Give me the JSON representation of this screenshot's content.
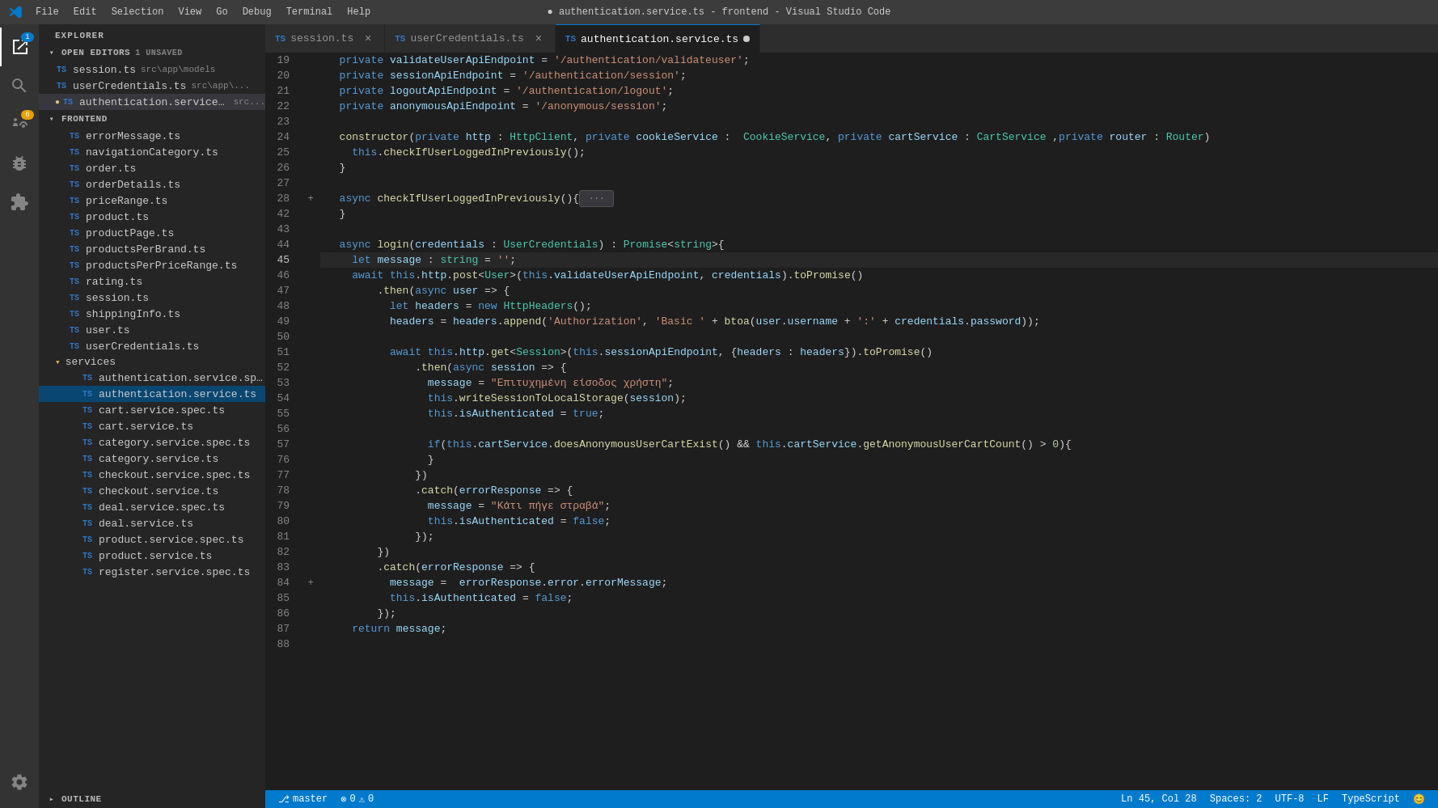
{
  "titlebar": {
    "title": "● authentication.service.ts - frontend - Visual Studio Code",
    "menu_items": [
      "File",
      "Edit",
      "Selection",
      "View",
      "Go",
      "Debug",
      "Terminal",
      "Help"
    ]
  },
  "tabs": [
    {
      "id": "session",
      "label": "session.ts",
      "type": "ts",
      "active": false,
      "unsaved": false
    },
    {
      "id": "userCredentials",
      "label": "userCredentials.ts",
      "type": "ts",
      "active": false,
      "unsaved": false
    },
    {
      "id": "authService",
      "label": "authentication.service.ts",
      "type": "ts",
      "active": true,
      "unsaved": true
    }
  ],
  "sidebar": {
    "title": "EXPLORER",
    "open_editors_label": "OPEN EDITORS",
    "open_editors_badge": "1 UNSAVED",
    "frontend_label": "FRONTEND",
    "outline_label": "OUTLINE",
    "open_files": [
      {
        "name": "session.ts",
        "path": "src\\app\\models",
        "type": "ts",
        "unsaved": false
      },
      {
        "name": "userCredentials.ts",
        "path": "src\\app\\...",
        "type": "ts",
        "unsaved": false
      },
      {
        "name": "authentication.service.ts",
        "path": "src...",
        "type": "ts",
        "unsaved": true,
        "dot": true
      }
    ],
    "files": [
      {
        "name": "errorMessage.ts",
        "type": "ts",
        "indent": 2
      },
      {
        "name": "navigationCategory.ts",
        "type": "ts",
        "indent": 2
      },
      {
        "name": "order.ts",
        "type": "ts",
        "indent": 2
      },
      {
        "name": "orderDetails.ts",
        "type": "ts",
        "indent": 2
      },
      {
        "name": "priceRange.ts",
        "type": "ts",
        "indent": 2
      },
      {
        "name": "product.ts",
        "type": "ts",
        "indent": 2
      },
      {
        "name": "productPage.ts",
        "type": "ts",
        "indent": 2
      },
      {
        "name": "productsPerBrand.ts",
        "type": "ts",
        "indent": 2
      },
      {
        "name": "productsPerPriceRange.ts",
        "type": "ts",
        "indent": 2
      },
      {
        "name": "rating.ts",
        "type": "ts",
        "indent": 2
      },
      {
        "name": "session.ts",
        "type": "ts",
        "indent": 2
      },
      {
        "name": "shippingInfo.ts",
        "type": "ts",
        "indent": 2
      },
      {
        "name": "user.ts",
        "type": "ts",
        "indent": 2
      },
      {
        "name": "userCredentials.ts",
        "type": "ts",
        "indent": 2
      },
      {
        "name": "services",
        "type": "folder",
        "indent": 1
      },
      {
        "name": "authentication.service.sp...",
        "type": "ts",
        "indent": 3
      },
      {
        "name": "authentication.service.ts",
        "type": "ts",
        "indent": 3,
        "active": true
      },
      {
        "name": "cart.service.spec.ts",
        "type": "ts",
        "indent": 3
      },
      {
        "name": "cart.service.ts",
        "type": "ts",
        "indent": 3
      },
      {
        "name": "category.service.spec.ts",
        "type": "ts",
        "indent": 3
      },
      {
        "name": "category.service.ts",
        "type": "ts",
        "indent": 3
      },
      {
        "name": "checkout.service.spec.ts",
        "type": "ts",
        "indent": 3
      },
      {
        "name": "checkout.service.ts",
        "type": "ts",
        "indent": 3
      },
      {
        "name": "deal.service.spec.ts",
        "type": "ts",
        "indent": 3
      },
      {
        "name": "deal.service.ts",
        "type": "ts",
        "indent": 3
      },
      {
        "name": "product.service.spec.ts",
        "type": "ts",
        "indent": 3
      },
      {
        "name": "product.service.ts",
        "type": "ts",
        "indent": 3
      },
      {
        "name": "register.service.spec.ts",
        "type": "ts",
        "indent": 3
      }
    ]
  },
  "code_lines": [
    {
      "num": 19,
      "content": "  private validateUserApiEndpoint = '/authentication/validateuser';"
    },
    {
      "num": 20,
      "content": "  private sessionApiEndpoint = '/authentication/session';"
    },
    {
      "num": 21,
      "content": "  private logoutApiEndpoint = '/authentication/logout';"
    },
    {
      "num": 22,
      "content": "  private anonymousApiEndpoint = '/anonymous/session';"
    },
    {
      "num": 23,
      "content": ""
    },
    {
      "num": 24,
      "content": "  constructor(private http : HttpClient, private cookieService :  CookieService, private cartService : CartService ,private router : Router)"
    },
    {
      "num": 25,
      "content": "    this.checkIfUserLoggedInPreviously();"
    },
    {
      "num": 26,
      "content": "  }"
    },
    {
      "num": 27,
      "content": ""
    },
    {
      "num": 28,
      "content": "  async checkIfUserLoggedInPreviously(){ ···",
      "folded": true
    },
    {
      "num": 42,
      "content": "  }"
    },
    {
      "num": 43,
      "content": ""
    },
    {
      "num": 44,
      "content": "  async login(credentials : UserCredentials) : Promise<string>{"
    },
    {
      "num": 45,
      "content": "    let message : string = '';",
      "current": true
    },
    {
      "num": 46,
      "content": "    await this.http.post<User>(this.validateUserApiEndpoint, credentials).toPromise()"
    },
    {
      "num": 47,
      "content": "        .then(async user => {"
    },
    {
      "num": 48,
      "content": "          let headers = new HttpHeaders();"
    },
    {
      "num": 49,
      "content": "          headers = headers.append('Authorization', 'Basic ' + btoa(user.username + ':' + credentials.password));"
    },
    {
      "num": 50,
      "content": ""
    },
    {
      "num": 51,
      "content": "          await this.http.get<Session>(this.sessionApiEndpoint, {headers : headers}).toPromise()"
    },
    {
      "num": 52,
      "content": "              .then(async session => {"
    },
    {
      "num": 53,
      "content": "                message = \"Επιτυχημένη είσοδος χρήστη\";"
    },
    {
      "num": 54,
      "content": "                this.writeSessionToLocalStorage(session);"
    },
    {
      "num": 55,
      "content": "                this.isAuthenticated = true;"
    },
    {
      "num": 56,
      "content": ""
    },
    {
      "num": 57,
      "content": "                if(this.cartService.doesAnonymousUserCartExist() && this.cartService.getAnonymousUserCartCount() > 0){",
      "folded_end": true
    },
    {
      "num": 76,
      "content": "                }"
    },
    {
      "num": 77,
      "content": "              })"
    },
    {
      "num": 78,
      "content": "              .catch(errorResponse => {"
    },
    {
      "num": 79,
      "content": "                message = \"Κάτι πήγε στραβά\";"
    },
    {
      "num": 80,
      "content": "                this.isAuthenticated = false;"
    },
    {
      "num": 81,
      "content": "              });"
    },
    {
      "num": 82,
      "content": "        })"
    },
    {
      "num": 83,
      "content": "        .catch(errorResponse => {"
    },
    {
      "num": 84,
      "content": "          message =  errorResponse.error.errorMessage;"
    },
    {
      "num": 85,
      "content": "          this.isAuthenticated = false;"
    },
    {
      "num": 86,
      "content": "        });"
    },
    {
      "num": 87,
      "content": "    return message;"
    },
    {
      "num": 88,
      "content": ""
    }
  ],
  "status_bar": {
    "branch": "master",
    "errors": "0",
    "warnings": "0",
    "line": "45",
    "col": "28",
    "spaces": "Spaces: 2",
    "encoding": "UTF-8",
    "line_ending": "LF",
    "language": "TypeScript",
    "feedback": "😊"
  }
}
